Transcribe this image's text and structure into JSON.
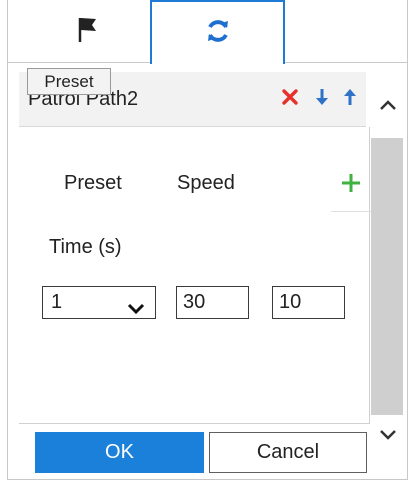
{
  "tabs": {
    "preset": {
      "icon": "flag-icon"
    },
    "patrol": {
      "icon": "refresh-icon",
      "active": true
    },
    "tooltip": "Preset"
  },
  "patrol": {
    "name": "Patrol Path2",
    "actions": {
      "delete_icon": "close-icon",
      "move_down_icon": "arrow-down-icon",
      "move_up_icon": "arrow-up-icon"
    },
    "columns": {
      "preset": "Preset",
      "speed": "Speed",
      "time": "Time (s)"
    },
    "add_icon": "plus-icon",
    "rows": [
      {
        "preset": "1",
        "speed": "30",
        "time": "10"
      }
    ]
  },
  "buttons": {
    "ok": "OK",
    "cancel": "Cancel"
  },
  "colors": {
    "accent": "#1b80d9",
    "delete": "#e8302a",
    "add": "#3fb23f",
    "arrow": "#2f73c9"
  }
}
